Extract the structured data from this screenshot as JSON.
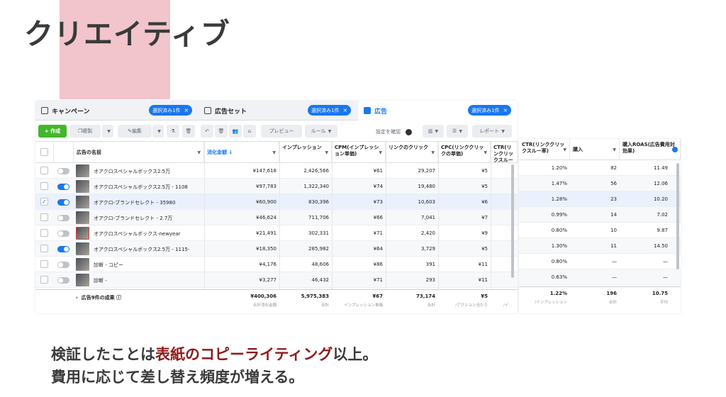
{
  "slide": {
    "title": "クリエイティブ",
    "caption1_pre": "検証したことは",
    "caption1_highlight": "表紙のコピーライティング",
    "caption1_post": "以上。",
    "caption2": "費用に応じて差し替え頻度が増える。"
  },
  "tabs": {
    "campaign": {
      "label": "キャンペーン",
      "chip": "選択済み1件"
    },
    "adset": {
      "label": "広告セット",
      "chip": "選択済み1件"
    },
    "ad": {
      "label": "広告",
      "chip": "選択済み1件"
    }
  },
  "toolbar": {
    "create": "+ 作成",
    "duplicate": "複製",
    "edit": "編集",
    "preview": "プレビュー",
    "rules": "ルール",
    "settings_confirm": "設定を確認",
    "report": "レポート"
  },
  "columns": {
    "name": "広告の名前",
    "spend": "消化金額 ↓",
    "impressions": "インプレッション",
    "cpm": "CPM(インプレッション単価)",
    "link_clicks": "リンクのクリック",
    "cpc": "CPC(リンククリックの単価)",
    "ctr_short": "CTR(リンクリックスルー率)",
    "ctr": "CTR(リンククリックスルー率)",
    "purchases": "購入",
    "roas": "購入ROAS(広告費用対効果)"
  },
  "rows": [
    {
      "name": "オアクロスペシャルボックス2.5万",
      "spend": "¥147,618",
      "imp": "2,426,566",
      "cpm": "¥61",
      "clicks": "29,207",
      "cpc": "¥5",
      "ctr": "1.20%",
      "purchases": "82",
      "roas": "11.49",
      "on": false,
      "checked": false
    },
    {
      "name": "オアクロスペシャルボックス2.5万 - 1108",
      "spend": "¥97,783",
      "imp": "1,322,340",
      "cpm": "¥74",
      "clicks": "19,480",
      "cpc": "¥5",
      "ctr": "1.47%",
      "purchases": "56",
      "roas": "12.06",
      "on": true,
      "checked": false
    },
    {
      "name": "オアクロ-ブランドセレクト - 35980",
      "spend": "¥60,900",
      "imp": "830,396",
      "cpm": "¥73",
      "clicks": "10,603",
      "cpc": "¥6",
      "ctr": "1.28%",
      "purchases": "23",
      "roas": "10.20",
      "on": true,
      "checked": true
    },
    {
      "name": "オアクロ-ブランドセレクト - 2.7万",
      "spend": "¥46,624",
      "imp": "711,706",
      "cpm": "¥66",
      "clicks": "7,041",
      "cpc": "¥7",
      "ctr": "0.99%",
      "purchases": "14",
      "roas": "7.02",
      "on": false,
      "checked": false
    },
    {
      "name": "オアクロスペシャルボックス-newyear",
      "spend": "¥21,491",
      "imp": "302,331",
      "cpm": "¥71",
      "clicks": "2,420",
      "cpc": "¥9",
      "ctr": "0.80%",
      "purchases": "10",
      "roas": "9.87",
      "on": false,
      "checked": false
    },
    {
      "name": "オアクロスペシャルボックス2.5万 - 1115-",
      "spend": "¥18,350",
      "imp": "285,982",
      "cpm": "¥64",
      "clicks": "3,729",
      "cpc": "¥5",
      "ctr": "1.30%",
      "purchases": "11",
      "roas": "14.50",
      "on": true,
      "checked": false
    },
    {
      "name": "診断 - コピー",
      "spend": "¥4,176",
      "imp": "48,606",
      "cpm": "¥86",
      "clicks": "391",
      "cpc": "¥11",
      "ctr": "0.80%",
      "purchases": "—",
      "roas": "—",
      "on": false,
      "checked": false
    },
    {
      "name": "診断 -",
      "spend": "¥3,277",
      "imp": "46,432",
      "cpm": "¥71",
      "clicks": "293",
      "cpc": "¥11",
      "ctr": "0.63%",
      "purchases": "—",
      "roas": "—",
      "on": false,
      "checked": false
    }
  ],
  "total": {
    "label": "広告9件の成果",
    "spend": "¥400,306",
    "spend_sub": "合計消化金額",
    "imp": "5,975,383",
    "imp_sub": "合計",
    "cpm": "¥67",
    "cpm_sub": "インプレッション単価",
    "clicks": "73,174",
    "clicks_sub": "合計",
    "cpc": "¥5",
    "cpc_sub": "/アクション当たり",
    "ctr_sub_short": "/イ",
    "ctr": "1.22%",
    "ctr_sub": "/インプレッション",
    "purchases": "196",
    "purchases_sub": "合計",
    "roas": "10.75",
    "roas_sub": "平均"
  },
  "colors": {
    "accent": "#1877f2",
    "create": "#42b72a",
    "highlight": "#8e1b1b",
    "pink": "#f2c4cc"
  }
}
